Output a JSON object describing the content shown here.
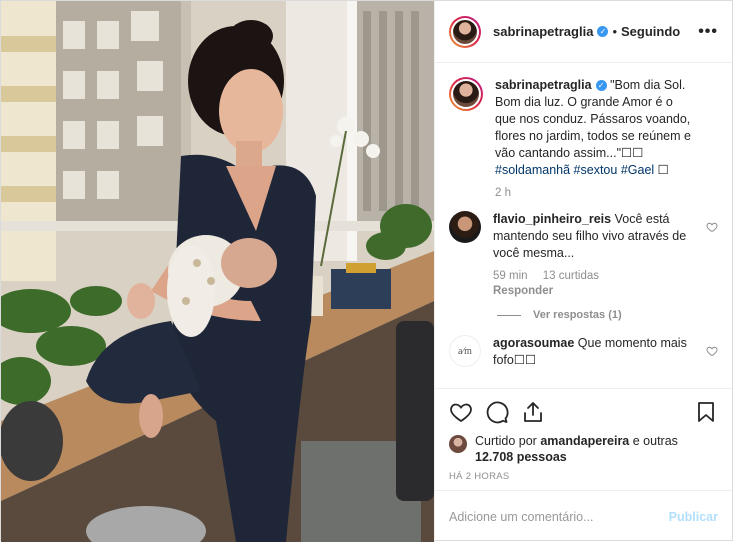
{
  "header": {
    "username": "sabrinapetraglia",
    "separator": "•",
    "follow_status": "Seguindo",
    "more": "•••"
  },
  "caption": {
    "username": "sabrinapetraglia",
    "text": "\"Bom dia Sol. Bom dia luz. O grande Amor é o que nos conduz. Pássaros voando, flores no jardim, todos se reúnem e vão cantando assim...\"☐☐ ",
    "tag1": "#soldamanhã",
    "tag2": "#sextou",
    "tag3": "#Gael",
    "end": " ☐",
    "time": "2 h"
  },
  "comments": [
    {
      "username": "flavio_pinheiro_reis",
      "text": "Você está mantendo seu filho vivo através de você mesma...",
      "time": "59 min",
      "likes": "13 curtidas",
      "reply": "Responder",
      "view_replies": "Ver respostas (1)"
    },
    {
      "username": "agorasoumae",
      "avatar_text": "a⁄m",
      "text": "Que momento mais fofo☐☐"
    }
  ],
  "likes": {
    "prefix": "Curtido por",
    "user": "amandapereira",
    "middle": "e outras",
    "count": "12.708 pessoas"
  },
  "timestamp": "HÁ 2 HORAS",
  "add_comment": {
    "placeholder": "Adicione um comentário...",
    "publish": "Publicar"
  },
  "icons": {
    "like": "heart-icon",
    "comment": "comment-icon",
    "share": "share-icon",
    "save": "bookmark-icon"
  },
  "colors": {
    "verified": "#3897f0",
    "tag": "#003569",
    "publish_disabled": "#b2dffc",
    "muted": "#8e8e8e"
  }
}
